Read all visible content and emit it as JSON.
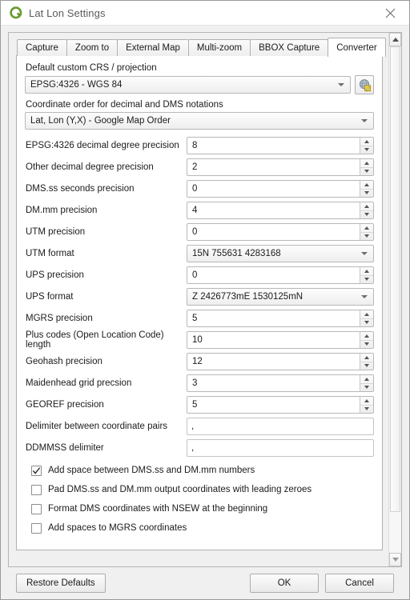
{
  "window": {
    "title": "Lat Lon Settings",
    "app_icon": "qgis-logo-icon",
    "close_label": "✕"
  },
  "tabs": [
    {
      "label": "Capture",
      "active": false
    },
    {
      "label": "Zoom to",
      "active": false
    },
    {
      "label": "External Map",
      "active": false
    },
    {
      "label": "Multi-zoom",
      "active": false
    },
    {
      "label": "BBOX Capture",
      "active": false
    },
    {
      "label": "Converter",
      "active": true
    }
  ],
  "converter": {
    "crs_label": "Default custom CRS / projection",
    "crs_value": "EPSG:4326 - WGS 84",
    "crs_button_icon": "globe-select-crs-icon",
    "order_label": "Coordinate order for decimal and DMS notations",
    "order_value": "Lat, Lon (Y,X) - Google Map Order",
    "rows": [
      {
        "label": "EPSG:4326 decimal degree precision",
        "value": "8",
        "type": "spinbox"
      },
      {
        "label": "Other decimal degree precision",
        "value": "2",
        "type": "spinbox"
      },
      {
        "label": "DMS.ss seconds precision",
        "value": "0",
        "type": "spinbox"
      },
      {
        "label": "DM.mm precision",
        "value": "4",
        "type": "spinbox"
      },
      {
        "label": "UTM precision",
        "value": "0",
        "type": "spinbox"
      },
      {
        "label": "UTM format",
        "value": "15N 755631 4283168",
        "type": "combo"
      },
      {
        "label": "UPS precision",
        "value": "0",
        "type": "spinbox"
      },
      {
        "label": "UPS format",
        "value": "Z 2426773mE 1530125mN",
        "type": "combo"
      },
      {
        "label": "MGRS precision",
        "value": "5",
        "type": "spinbox"
      },
      {
        "label": "Plus codes (Open Location Code) length",
        "value": "10",
        "type": "spinbox"
      },
      {
        "label": "Geohash precision",
        "value": "12",
        "type": "spinbox"
      },
      {
        "label": "Maidenhead grid precsion",
        "value": "3",
        "type": "spinbox"
      },
      {
        "label": "GEOREF precision",
        "value": "5",
        "type": "spinbox"
      },
      {
        "label": "Delimiter between coordinate pairs",
        "value": ",",
        "type": "text"
      },
      {
        "label": "DDMMSS delimiter",
        "value": ",",
        "type": "text"
      }
    ],
    "checkboxes": [
      {
        "label": "Add space between DMS.ss and DM.mm numbers",
        "checked": true
      },
      {
        "label": "Pad DMS.ss and DM.mm output coordinates with leading zeroes",
        "checked": false
      },
      {
        "label": "Format DMS coordinates with NSEW at the beginning",
        "checked": false
      },
      {
        "label": "Add spaces to MGRS coordinates",
        "checked": false
      }
    ]
  },
  "footer": {
    "restore_defaults": "Restore Defaults",
    "ok": "OK",
    "cancel": "Cancel"
  },
  "colors": {
    "accent_green": "#6a9a2e",
    "window_bg": "#f0f0f0",
    "panel_bg": "#ffffff"
  }
}
